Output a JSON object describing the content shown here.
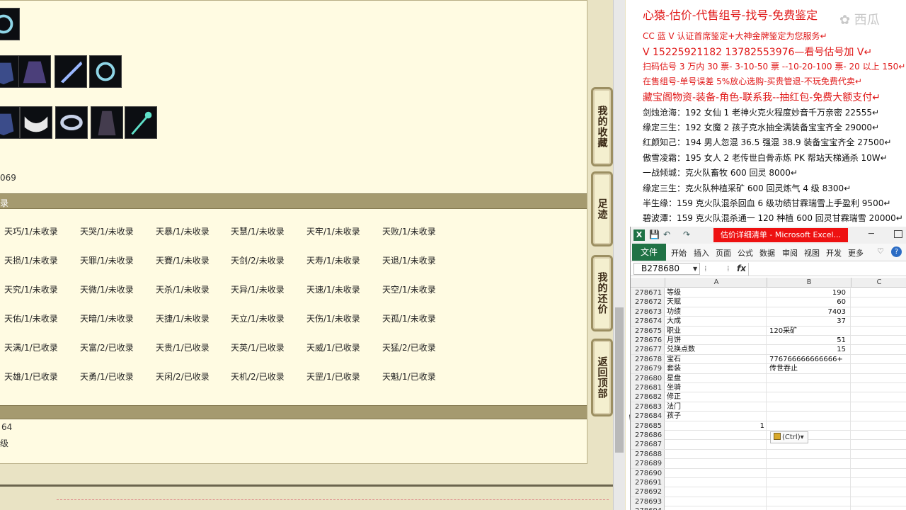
{
  "left": {
    "stat_top": "069",
    "section1_label": "录",
    "titles": [
      [
        "天巧/1/未收录",
        "天哭/1/未收录",
        "天暴/1/未收录",
        "天慧/1/未收录",
        "天牢/1/未收录",
        "天败/1/未收录"
      ],
      [
        "天损/1/未收录",
        "天罪/1/未收录",
        "天賽/1/未收录",
        "天剑/2/未收录",
        "天寿/1/未收录",
        "天退/1/未收录"
      ],
      [
        "天究/1/未收录",
        "天微/1/未收录",
        "天杀/1/未收录",
        "天异/1/未收录",
        "天速/1/未收录",
        "天空/1/未收录"
      ],
      [
        "天佑/1/未收录",
        "天暗/1/未收录",
        "天捷/1/未收录",
        "天立/1/未收录",
        "天伤/1/未收录",
        "天孤/1/未收录"
      ],
      [
        "天满/1/已收录",
        "天富/2/已收录",
        "天贵/1/已收录",
        "天英/1/已收录",
        "天威/1/已收录",
        "天猛/2/已收录"
      ],
      [
        "天雄/1/已收录",
        "天勇/1/已收录",
        "天闲/2/已收录",
        "天机/2/已收录",
        "天罡/1/已收录",
        "天魁/1/已收录"
      ]
    ],
    "stat_bottom1": "64",
    "stat_bottom2": "级",
    "side_buttons": [
      "我的收藏",
      "足迹",
      "我的还价",
      "返回顶部"
    ],
    "item_icons": [
      "ring-icon",
      "armor-icon",
      "cape-icon",
      "blade-icon",
      "ring-icon",
      "armor-icon",
      "collar-icon",
      "bracelet-icon",
      "robe-icon",
      "staff-icon"
    ]
  },
  "right_text": {
    "watermark": "✿ 西瓜",
    "lines": [
      {
        "text": "心猿-估价-代售组号-找号-免费鉴定",
        "style": "red",
        "size": "large"
      },
      {
        "text": "CC 蓝 V 认证首席鉴定+大神金牌鉴定为您服务↵",
        "style": "red"
      },
      {
        "text": "V 15225921182      13782553976—看号估号加 V↵",
        "style": "red",
        "size": "medium"
      },
      {
        "text": "扫码估号 3 万内 30 票- 3-10-50 票  --10-20-100 票- 20 以上 150↵",
        "style": "red"
      },
      {
        "text": "在售组号-单号误差 5%放心选购-买贵管退-不玩免费代卖↵",
        "style": "red"
      },
      {
        "text": "藏宝阁物资-装备-角色-联系我--抽红包-免费大额支付↵",
        "style": "red",
        "size": "medium"
      },
      {
        "text": "剑烛沧海：192 女仙 1 老神火克火程度妙音千万亲密 22555↵",
        "style": "dark"
      },
      {
        "text": "缘定三生：192 女魔 2 孩子克水抽全满装备宝宝齐全 29000↵",
        "style": "dark"
      },
      {
        "text": "红颜知己：194 男人忽混 36.5 强混 38.9 装备宝宝齐全 27500↵",
        "style": "dark"
      },
      {
        "text": "傲雪凌霜：195 女人 2 老传世白骨赤炼 PK 帮站天梯通杀 10W↵",
        "style": "dark"
      },
      {
        "text": "一战倾城：克火队畜牧 600 回灵 8000↵",
        "style": "dark"
      },
      {
        "text": "缘定三生：克火队种植采矿 600 回灵炼气 4 级 8300↵",
        "style": "dark"
      },
      {
        "text": "半生缘：159 克火队混杀回血 6 级功绩甘霖瑞雪上手盈利 9500↵",
        "style": "dark"
      },
      {
        "text": "碧波潭：159 克火队混杀通一 120 种植 600 回灵甘霖瑞雪 20000↵",
        "style": "dark"
      }
    ]
  },
  "excel": {
    "title": "估价详细清单 - Microsoft Excel...",
    "quick_access": [
      "💾",
      "↶",
      "↷"
    ],
    "file_tab": "文件",
    "tabs": [
      "开始",
      "插入",
      "页面",
      "公式",
      "数据",
      "审阅",
      "视图",
      "开发",
      "更多"
    ],
    "help": "?",
    "name_box": "B278680",
    "fx": "fx",
    "columns": [
      "A",
      "B",
      "C"
    ],
    "rows": [
      {
        "num": "278671",
        "a": "等级",
        "b": "190",
        "b_type": "num"
      },
      {
        "num": "278672",
        "a": "天赋",
        "b": "60",
        "b_type": "num"
      },
      {
        "num": "278673",
        "a": "功绩",
        "b": "7403",
        "b_type": "num"
      },
      {
        "num": "278674",
        "a": "大成",
        "b": "37",
        "b_type": "num"
      },
      {
        "num": "278675",
        "a": "职业",
        "b": "120采矿",
        "b_type": "txt"
      },
      {
        "num": "278676",
        "a": "月饼",
        "b": "51",
        "b_type": "num"
      },
      {
        "num": "278677",
        "a": "兑换点数",
        "b": "15",
        "b_type": "num"
      },
      {
        "num": "278678",
        "a": "宝石",
        "b": "776766666666666+",
        "b_type": "txt"
      },
      {
        "num": "278679",
        "a": "套装",
        "b": "传世吞止",
        "b_type": "txt"
      },
      {
        "num": "278680",
        "a": "星盘",
        "b": "",
        "b_type": "txt"
      },
      {
        "num": "278681",
        "a": "坐骑",
        "b": "",
        "b_type": "txt"
      },
      {
        "num": "278682",
        "a": "修正",
        "b": "",
        "b_type": "txt"
      },
      {
        "num": "278683",
        "a": "法门",
        "b": "",
        "b_type": "txt"
      },
      {
        "num": "278684",
        "a": "孩子",
        "b": "",
        "b_type": "txt"
      },
      {
        "num": "278685",
        "a": "1",
        "b": "",
        "b_type": "txt",
        "a_num": true
      },
      {
        "num": "278686",
        "a": "",
        "b": "",
        "b_type": "txt"
      },
      {
        "num": "278687",
        "a": "",
        "b": "",
        "b_type": "txt"
      },
      {
        "num": "278688",
        "a": "",
        "b": "",
        "b_type": "txt"
      },
      {
        "num": "278689",
        "a": "",
        "b": "",
        "b_type": "txt"
      },
      {
        "num": "278690",
        "a": "",
        "b": "",
        "b_type": "txt"
      },
      {
        "num": "278691",
        "a": "",
        "b": "",
        "b_type": "txt"
      },
      {
        "num": "278692",
        "a": "",
        "b": "",
        "b_type": "txt"
      },
      {
        "num": "278693",
        "a": "",
        "b": "",
        "b_type": "txt"
      },
      {
        "num": "278694",
        "a": "",
        "b": "",
        "b_type": "txt"
      }
    ],
    "paste_options": "(Ctrl)▾"
  }
}
